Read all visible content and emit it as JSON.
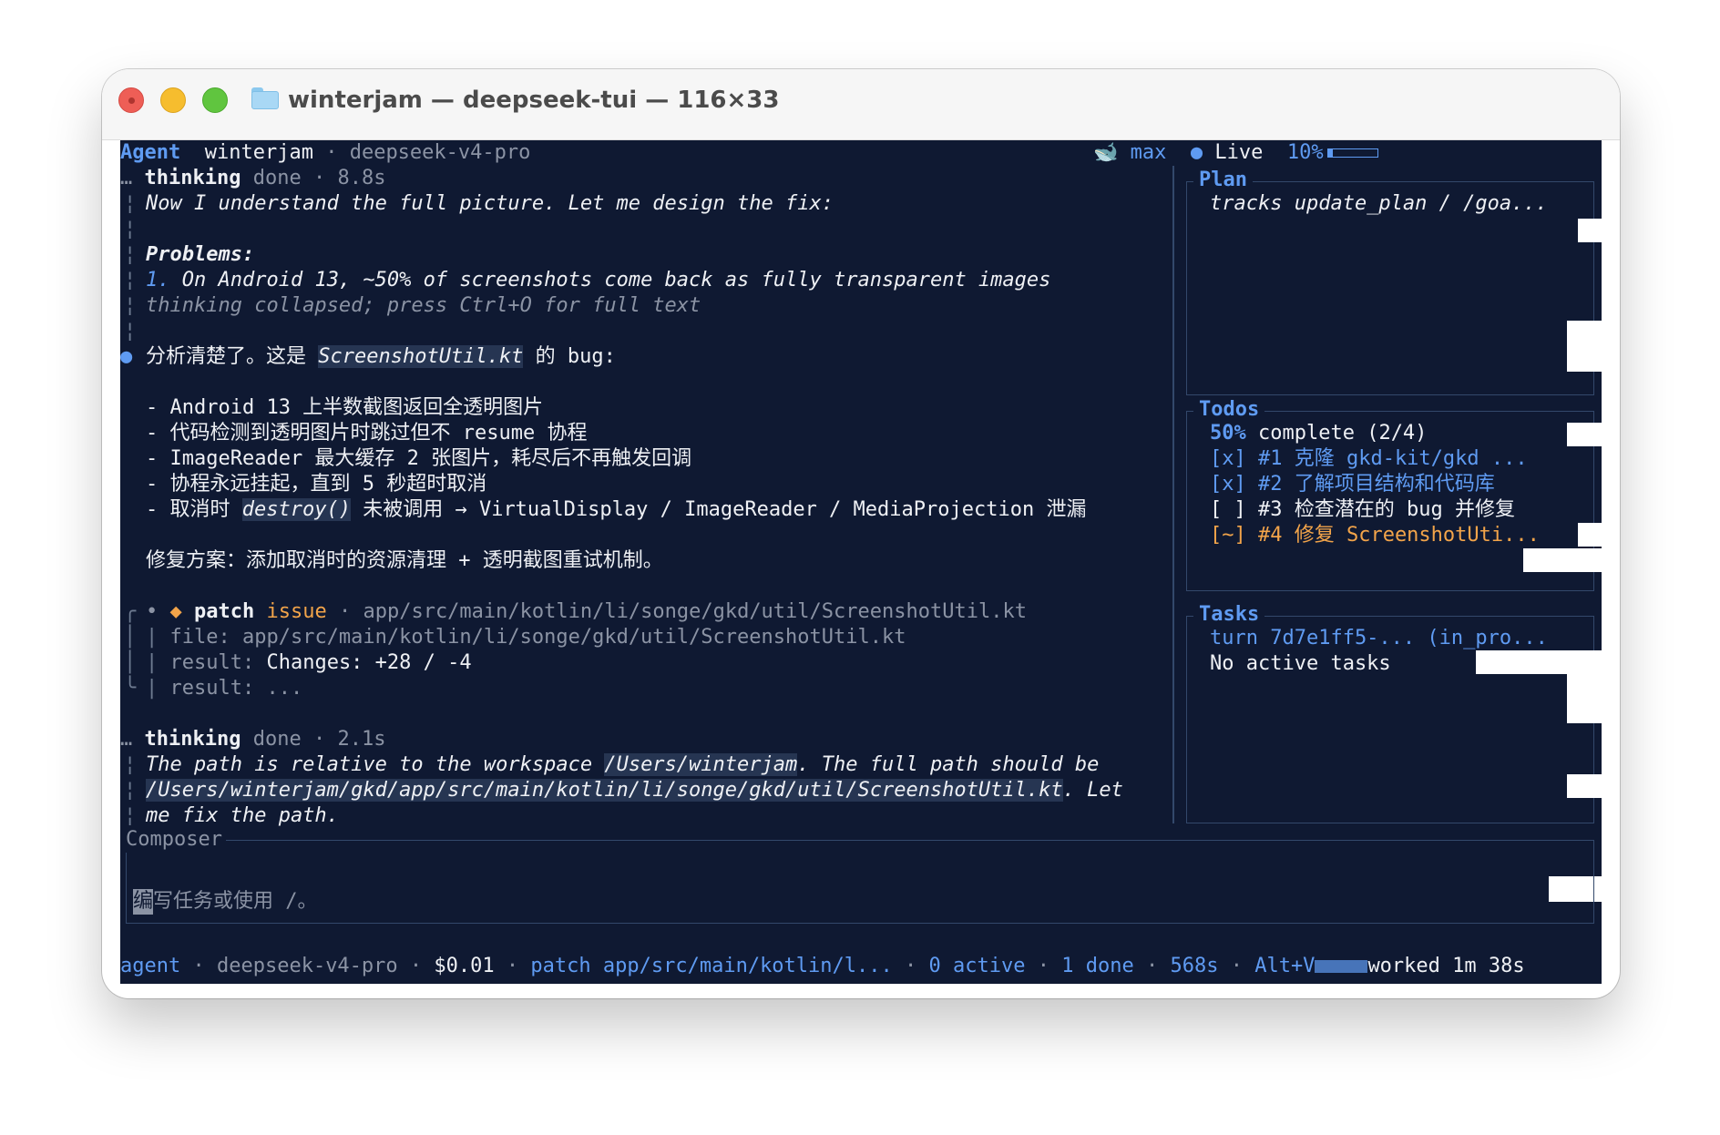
{
  "window": {
    "title": "winterjam — deepseek-tui — 116×33"
  },
  "header": {
    "mode": "Agent",
    "workspace": "winterjam",
    "sep": "·",
    "model": "deepseek-v4-pro",
    "whale": "🐋",
    "effort": "max",
    "live_dot": "●",
    "live": "Live",
    "percent": "10%",
    "progress_fraction": 0.1
  },
  "transcript": {
    "thinking1": {
      "marker": "…",
      "label": "thinking",
      "status": "done",
      "sep": "·",
      "time": "8.8s",
      "line1": "Now I understand the full picture. Let me design the fix:",
      "problems": "Problems:",
      "item_num": "1.",
      "item_text": "On Android 13, ~50% of screenshots come back as fully transparent images",
      "collapsed": "thinking collapsed; press Ctrl+O for full text"
    },
    "answer": {
      "bullet": "●",
      "intro_pre": "分析清楚了。这是 ",
      "intro_file": "ScreenshotUtil.kt",
      "intro_post": " 的 bug:",
      "items": [
        "- Android 13 上半数截图返回全透明图片",
        "- 代码检测到透明图片时跳过但不 resume 协程",
        "- ImageReader 最大缓存 2 张图片，耗尽后不再触发回调",
        "- 协程永远挂起，直到 5 秒超时取消"
      ],
      "item5_pre": "- 取消时 ",
      "item5_code": "destroy()",
      "item5_post": " 未被调用 → VirtualDisplay / ImageReader / MediaProjection 泄漏",
      "fix": "修复方案：添加取消时的资源清理 + 透明截图重试机制。"
    },
    "patch": {
      "dot": "•",
      "diamond": "◆",
      "label": "patch",
      "status": "issue",
      "sep": "·",
      "path": "app/src/main/kotlin/li/songe/gkd/util/ScreenshotUtil.kt",
      "file_line": "file: app/src/main/kotlin/li/songe/gkd/util/ScreenshotUtil.kt",
      "result_key": "result:",
      "result_val": "Changes: +28 / -4",
      "result2": "result: ..."
    },
    "thinking2": {
      "marker": "…",
      "label": "thinking",
      "status": "done",
      "sep": "·",
      "time": "2.1s",
      "line1_pre": "The path is relative to the workspace ",
      "line1_path": "/Users/winterjam",
      "line1_post": ". The full path should be",
      "line2_path": "/Users/winterjam/gkd/app/src/main/kotlin/li/songe/gkd/util/ScreenshotUtil.kt",
      "line2_post": ". Let",
      "line3": "me fix the path."
    }
  },
  "sidebar": {
    "plan": {
      "title": "Plan",
      "text": "tracks update_plan / /goa..."
    },
    "todos": {
      "title": "Todos",
      "pct": "50%",
      "summary": " complete (2/4)",
      "items": [
        "[x] #1 克隆 gkd-kit/gkd ...",
        "[x] #2 了解项目结构和代码库",
        "[ ] #3 检查潜在的 bug 并修复",
        "[~] #4 修复 ScreenshotUti..."
      ]
    },
    "tasks": {
      "title": "Tasks",
      "turn": "turn 7d7e1ff5-... (in_pro...",
      "none": "No active tasks"
    }
  },
  "composer": {
    "title": "Composer",
    "cursor_char": "编",
    "placeholder_rest": "写任务或使用 /。"
  },
  "status": {
    "mode": "agent",
    "sep": "·",
    "model": "deepseek-v4-pro",
    "cost": "$0.01",
    "activity": "patch app/src/main/kotlin/l...",
    "active": "0 active",
    "done": "1 done",
    "elapsed": "568s",
    "shortcut": "Alt+V",
    "worked": "worked 1m 38s"
  },
  "colors": {
    "background": "#0f1932",
    "accent": "#5f9bf2",
    "orange": "#f2a44a",
    "border": "#33486b"
  }
}
